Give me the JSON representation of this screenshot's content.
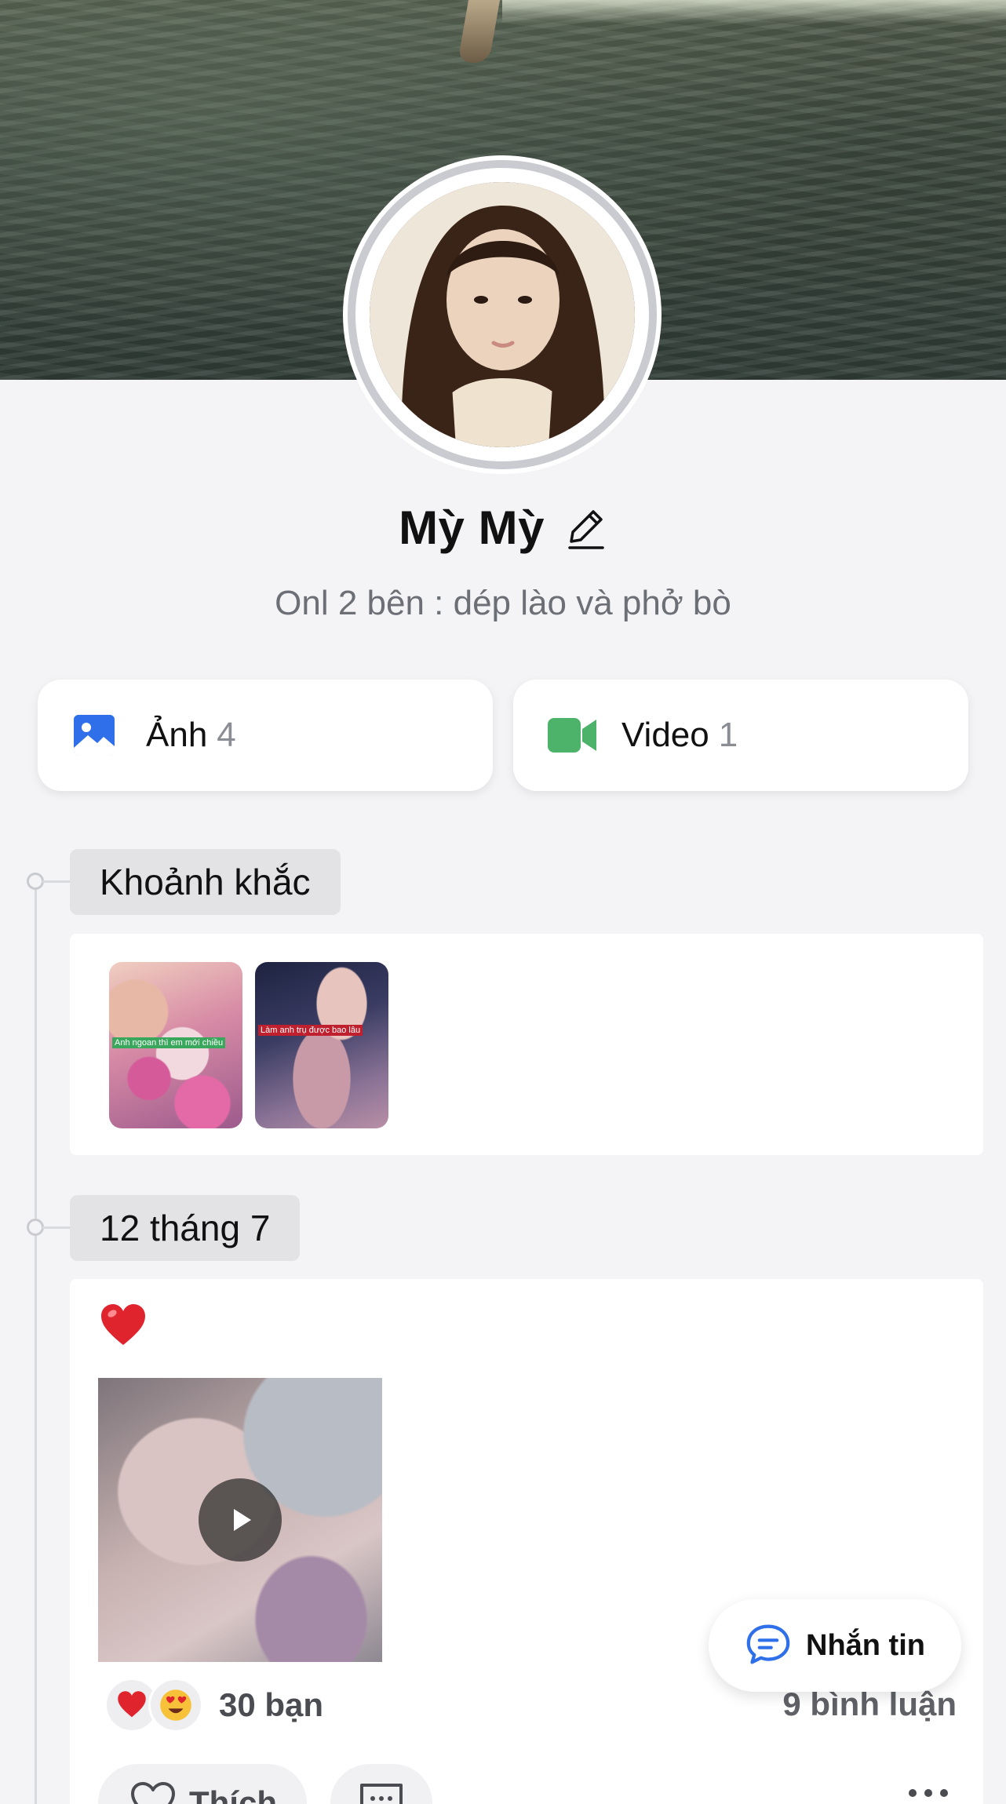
{
  "profile": {
    "name": "Mỳ Mỳ",
    "status": "Onl 2 bên : dép lào và phở bò"
  },
  "media": {
    "photos": {
      "label": "Ảnh",
      "count": "4",
      "icon": "image-icon",
      "color": "#2f6fea"
    },
    "videos": {
      "label": "Video",
      "count": "1",
      "icon": "video-camera-icon",
      "color": "#4db36a"
    }
  },
  "moments": {
    "title": "Khoảnh khắc",
    "items": [
      {
        "caption": "Anh ngoan thì em mới chiều"
      },
      {
        "caption": "Làm anh trụ được bao lâu"
      }
    ]
  },
  "post": {
    "date": "12 tháng 7",
    "emoji": "❤️",
    "reactions": [
      "❤️",
      "😍"
    ],
    "reaction_count": "30 bạn",
    "comment_count": "9 bình luận",
    "like_label": "Thích"
  },
  "fab": {
    "label": "Nhắn tin"
  }
}
